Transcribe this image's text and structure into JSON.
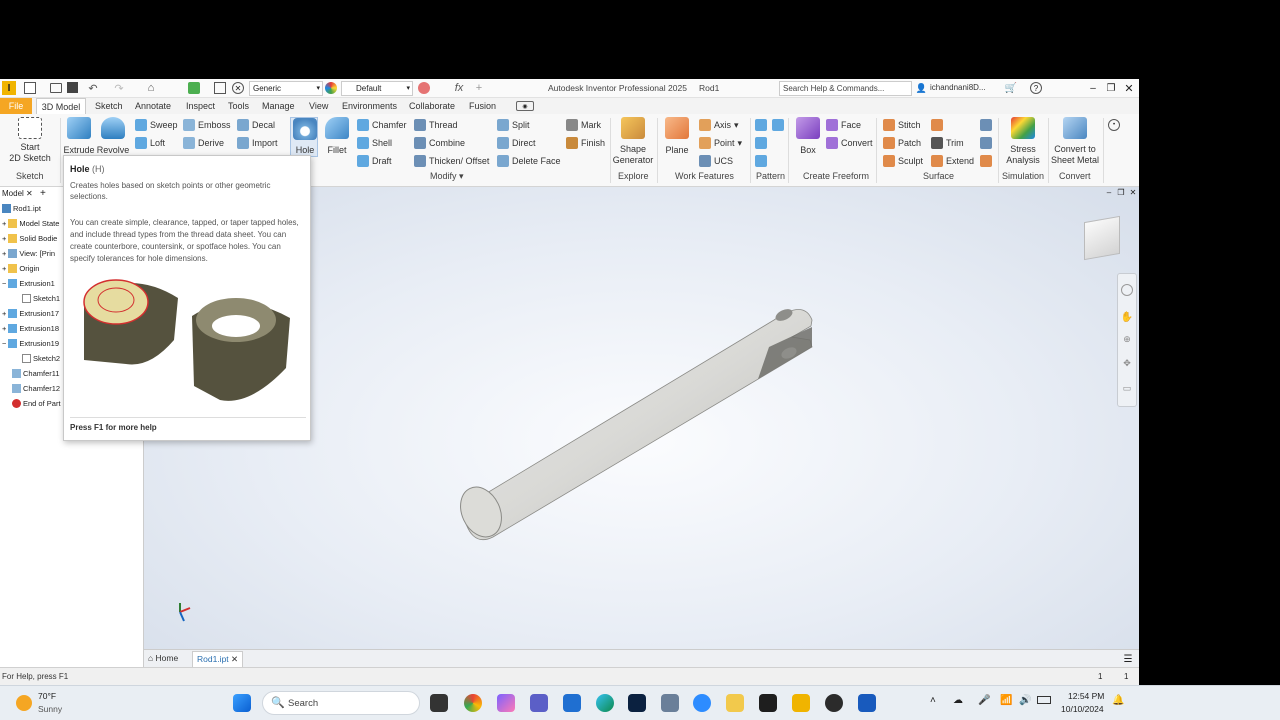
{
  "titlebar": {
    "app_title": "Autodesk Inventor Professional 2025",
    "doc_title": "Rod1",
    "material": "Generic",
    "appearance": "Default",
    "search_placeholder": "Search Help & Commands...",
    "user": "ichandnani8D..."
  },
  "tabs": [
    "File",
    "3D Model",
    "Sketch",
    "Annotate",
    "Inspect",
    "Tools",
    "Manage",
    "View",
    "Environments",
    "Collaborate",
    "Fusion"
  ],
  "ribbon": {
    "start_sketch": "Start",
    "start_sketch2": "2D Sketch",
    "extrude": "Extrude",
    "revolve": "Revolve",
    "sweep": "Sweep",
    "loft": "Loft",
    "emboss": "Emboss",
    "derive": "Derive",
    "decal": "Decal",
    "import": "Import",
    "hole": "Hole",
    "fillet": "Fillet",
    "chamfer": "Chamfer",
    "shell": "Shell",
    "draft": "Draft",
    "thread": "Thread",
    "combine": "Combine",
    "thicken": "Thicken/ Offset",
    "split": "Split",
    "direct": "Direct",
    "delete_face": "Delete Face",
    "mark": "Mark",
    "finish": "Finish",
    "shape_gen1": "Shape",
    "shape_gen2": "Generator",
    "plane": "Plane",
    "axis": "Axis",
    "point": "Point",
    "ucs": "UCS",
    "box": "Box",
    "face": "Face",
    "convert": "Convert",
    "stitch": "Stitch",
    "patch": "Patch",
    "sculpt": "Sculpt",
    "trim": "Trim",
    "extend": "Extend",
    "stress1": "Stress",
    "stress2": "Analysis",
    "sheet1": "Convert to",
    "sheet2": "Sheet Metal",
    "groups": {
      "sketch": "Sketch",
      "modify": "Modify",
      "explore": "Explore",
      "work": "Work Features",
      "pattern": "Pattern",
      "freeform": "Create Freeform",
      "surface": "Surface",
      "simulation": "Simulation",
      "convert": "Convert"
    }
  },
  "browser": {
    "tab": "Model",
    "items": [
      "Rod1.ipt",
      "Model State",
      "Solid Bodie",
      "View: [Prin",
      "Origin",
      "Extrusion1",
      "Sketch1",
      "Extrusion17",
      "Extrusion18",
      "Extrusion19",
      "Sketch2",
      "Chamfer11",
      "Chamfer12",
      "End of Part"
    ]
  },
  "tooltip": {
    "title": "Hole",
    "shortcut": "(H)",
    "line1": "Creates holes based on sketch points or other geometric selections.",
    "line2": "You can create simple, clearance, tapped, or taper tapped holes, and include thread types from the thread data sheet. You can create counterbore, countersink, or spotface holes. You can specify tolerances for hole dimensions.",
    "footer": "Press F1 for more help"
  },
  "doctabs": {
    "home": "Home",
    "doc": "Rod1.ipt"
  },
  "status": {
    "help": "For Help, press F1",
    "n1": "1",
    "n2": "1"
  },
  "taskbar": {
    "temp": "70°F",
    "weather": "Sunny",
    "search": "Search",
    "time": "12:54 PM",
    "date": "10/10/2024"
  },
  "colors": {
    "accent": "#f5a623",
    "file_tab": "#f5a623",
    "viewport": "#e8edf5"
  }
}
